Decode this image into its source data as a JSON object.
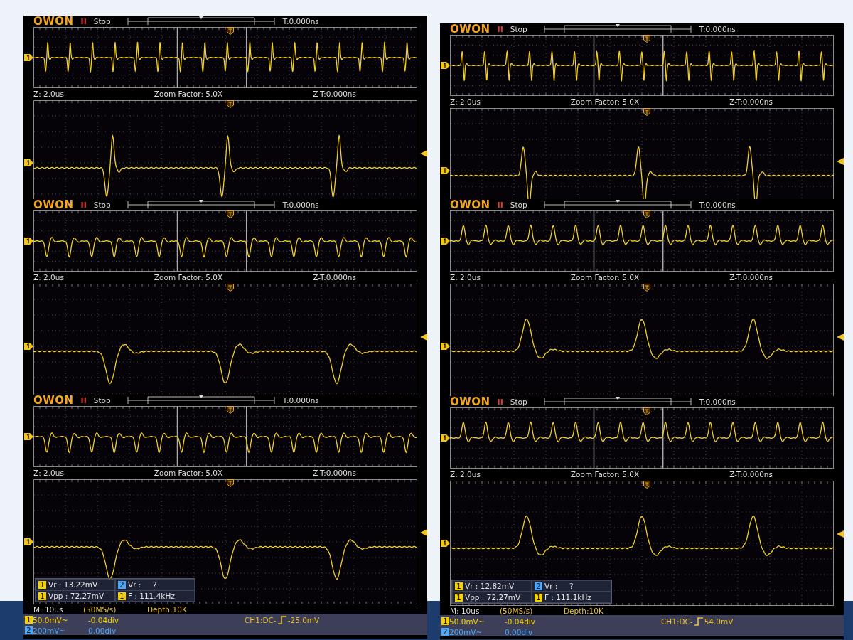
{
  "columns": [
    {
      "scopes": [
        {
          "header": {
            "brand": "OWON",
            "run_symbol": "II",
            "run_state": "Stop",
            "trigger_time": "T:0.000ns"
          },
          "zoom_info": {
            "timebase": "Z: 2.0us",
            "factor": "Zoom Factor: 5.0X",
            "zoom_time": "Z-T:0.000ns"
          },
          "trace": {
            "kind": "spike",
            "inverted": true
          }
        },
        {
          "header": {
            "brand": "OWON",
            "run_symbol": "II",
            "run_state": "Stop",
            "trigger_time": "T:0.000ns"
          },
          "zoom_info": {
            "timebase": "Z: 2.0us",
            "factor": "Zoom Factor: 5.0X",
            "zoom_time": "Z-T:0.000ns"
          },
          "trace": {
            "kind": "smooth",
            "inverted": true
          }
        },
        {
          "header": {
            "brand": "OWON",
            "run_symbol": "II",
            "run_state": "Stop",
            "trigger_time": "T:0.000ns"
          },
          "zoom_info": {
            "timebase": "Z: 2.0us",
            "factor": "Zoom Factor: 5.0X",
            "zoom_time": "Z-T:0.000ns"
          },
          "trace": {
            "kind": "smooth",
            "inverted": true
          },
          "measurements": [
            {
              "channel": "1",
              "text": "Vr : 13.22mV",
              "color": "#f5d000"
            },
            {
              "channel": "2",
              "text": "Vr :     ?",
              "color": "#4aa8ff"
            },
            {
              "channel": "1",
              "text": "Vpp : 72.27mV",
              "color": "#f5d000"
            },
            {
              "channel": "1",
              "text": "F : 111.4kHz",
              "color": "#f5d000"
            }
          ],
          "acquisition": {
            "timebase": "M: 10us",
            "sample_rate": "(50MS/s)",
            "depth": "Depth:10K"
          },
          "channels": [
            {
              "number": "1",
              "scale": "50.0mV~",
              "offset": "-0.04div",
              "color": "#f5d000"
            },
            {
              "number": "2",
              "scale": "200mV~",
              "offset": "0.00div",
              "color": "#4aa8ff"
            }
          ],
          "trigger": {
            "source": "CH1:DC-",
            "level": "-25.0mV"
          }
        }
      ]
    },
    {
      "scopes": [
        {
          "header": {
            "brand": "OWON",
            "run_symbol": "II",
            "run_state": "Stop",
            "trigger_time": "T:0.000ns"
          },
          "zoom_info": {
            "timebase": "Z: 2.0us",
            "factor": "Zoom Factor: 5.0X",
            "zoom_time": "Z-T:0.000ns"
          },
          "trace": {
            "kind": "spike",
            "inverted": false
          }
        },
        {
          "header": {
            "brand": "OWON",
            "run_symbol": "II",
            "run_state": "Stop",
            "trigger_time": "T:0.000ns"
          },
          "zoom_info": {
            "timebase": "Z: 2.0us",
            "factor": "Zoom Factor: 5.0X",
            "zoom_time": "Z-T:0.000ns"
          },
          "trace": {
            "kind": "smooth",
            "inverted": false
          }
        },
        {
          "header": {
            "brand": "OWON",
            "run_symbol": "II",
            "run_state": "Stop",
            "trigger_time": "T:0.000ns"
          },
          "zoom_info": {
            "timebase": "Z: 2.0us",
            "factor": "Zoom Factor: 5.0X",
            "zoom_time": "Z-T:0.000ns"
          },
          "trace": {
            "kind": "smooth",
            "inverted": false
          },
          "measurements": [
            {
              "channel": "1",
              "text": "Vr : 12.82mV",
              "color": "#f5d000"
            },
            {
              "channel": "2",
              "text": "Vr :     ?",
              "color": "#4aa8ff"
            },
            {
              "channel": "1",
              "text": "Vpp : 72.27mV",
              "color": "#f5d000"
            },
            {
              "channel": "1",
              "text": "F : 111.1kHz",
              "color": "#f5d000"
            }
          ],
          "acquisition": {
            "timebase": "M: 10us",
            "sample_rate": "(50MS/s)",
            "depth": "Depth:10K"
          },
          "channels": [
            {
              "number": "1",
              "scale": "50.0mV~",
              "offset": "-0.04div",
              "color": "#f5d000"
            },
            {
              "number": "2",
              "scale": "200mV~",
              "offset": "0.00div",
              "color": "#4aa8ff"
            }
          ],
          "trigger": {
            "source": "CH1:DC-",
            "level": "54.0mV"
          }
        }
      ]
    }
  ]
}
